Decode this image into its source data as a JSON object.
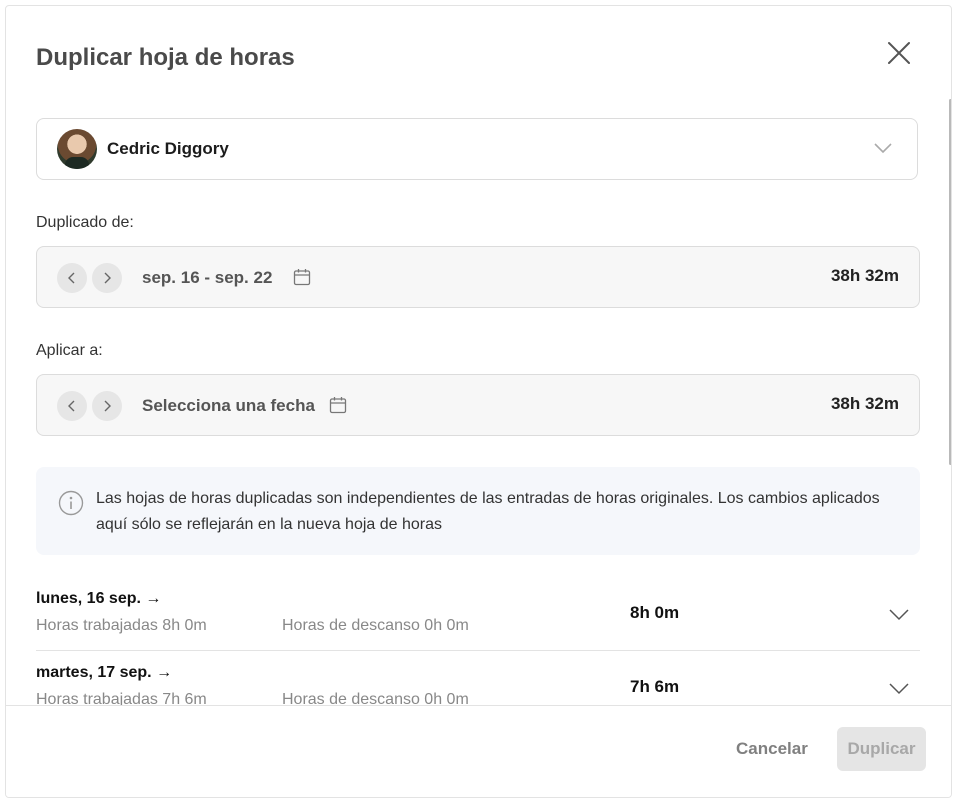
{
  "dialog": {
    "title": "Duplicar hoja de horas"
  },
  "employee": {
    "name": "Cedric Diggory"
  },
  "source": {
    "label": "Duplicado de:",
    "range": "sep. 16 - sep. 22",
    "total": "38h 32m"
  },
  "target": {
    "label": "Aplicar a:",
    "range": "Selecciona una fecha",
    "total": "38h 32m"
  },
  "info": {
    "text": "Las hojas de horas duplicadas son independientes de las entradas de horas originales. Los cambios aplicados aquí sólo se reflejarán en la nueva hoja de horas"
  },
  "days": [
    {
      "title": "lunes, 16 sep. →",
      "worked": "Horas trabajadas 8h 0m",
      "break": "Horas de descanso 0h 0m",
      "total": "8h 0m"
    },
    {
      "title": "martes, 17 sep. →",
      "worked": "Horas trabajadas 7h 6m",
      "break": "Horas de descanso 0h 0m",
      "total": "7h 6m"
    }
  ],
  "footer": {
    "cancel_label": "Cancelar",
    "duplicate_label": "Duplicar",
    "duplicate_disabled": true
  },
  "icons": [
    "close-icon",
    "chevron-down-icon",
    "chevron-left-icon",
    "chevron-right-icon",
    "calendar-icon",
    "info-icon"
  ]
}
